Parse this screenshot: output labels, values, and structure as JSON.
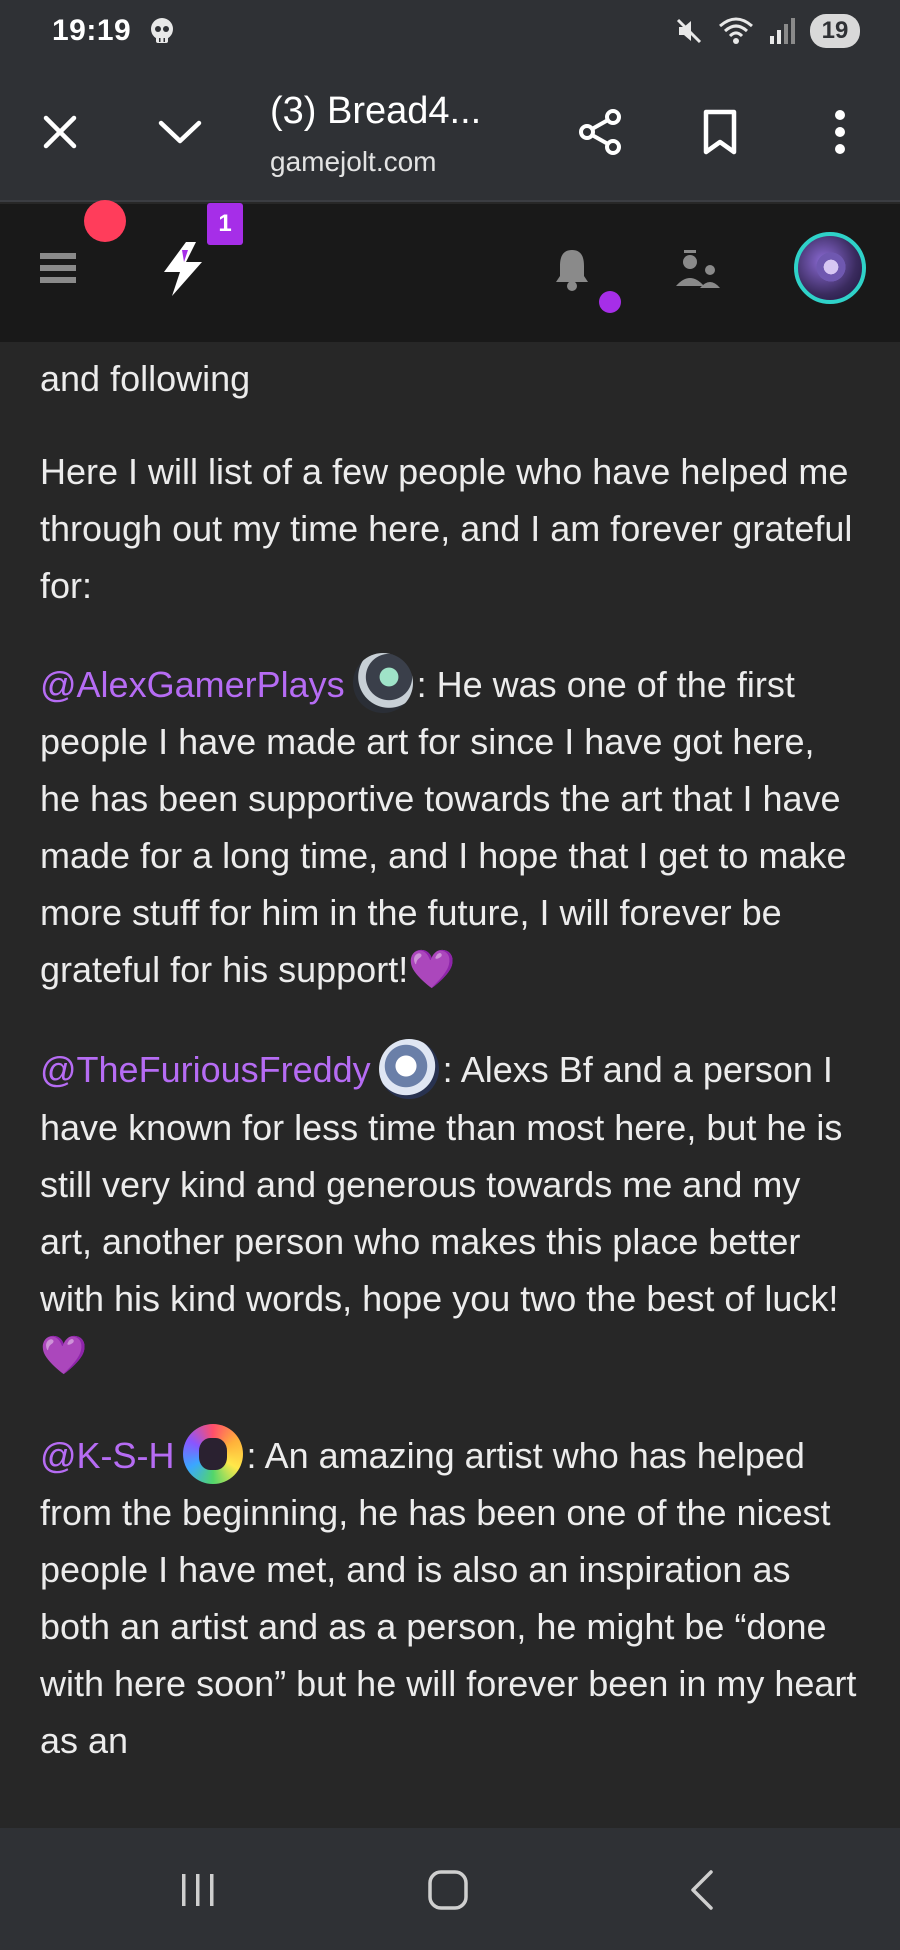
{
  "status_bar": {
    "time": "19:19",
    "battery_level": "19",
    "icons": [
      "skull-icon",
      "mute-icon",
      "wifi-icon",
      "signal-icon"
    ]
  },
  "browser": {
    "tab_title": "(3) Bread4...",
    "url": "gamejolt.com",
    "icons": [
      "close-icon",
      "chevron-down-icon",
      "share-icon",
      "bookmark-icon",
      "more-vert-icon"
    ]
  },
  "site_nav": {
    "activity_count": "1",
    "icons": [
      "menu-icon",
      "activity-bolt-icon",
      "notifications-bell-icon",
      "friend-requests-icon",
      "user-avatar"
    ]
  },
  "post": {
    "intro_tail": "and following",
    "list_intro": "Here I will list of a few people who have helped me through out my time here, and I am forever grateful for:",
    "entries": [
      {
        "mention": "@AlexGamerPlays",
        "text": ": He was one of the first people I have made art for since I have got here, he has been supportive towards the art that I have made for a long time, and I hope that I get to make more stuff for him in the future, I will forever be grateful for his support!",
        "emoji": "💜"
      },
      {
        "mention": "@TheFuriousFreddy",
        "text": ": Alexs Bf and a person I have known for less time than most here, but he is still very kind and generous towards me and my art, another person who makes this place better with his kind words, hope you two the best of luck! ",
        "emoji": "💜"
      },
      {
        "mention": "@K-S-H",
        "text": ": An amazing artist who has helped from the beginning, he has been one of the nicest people I have met, and is also an inspiration as both an artist and as a person, he might be “done with here soon” but he will forever been in my heart as an",
        "emoji": ""
      }
    ]
  },
  "colors": {
    "mention": "#b66cf4",
    "badge": "#a62ee8",
    "notification_dot": "#ff3d5b",
    "background": "#272727",
    "nav_background": "#191919"
  }
}
